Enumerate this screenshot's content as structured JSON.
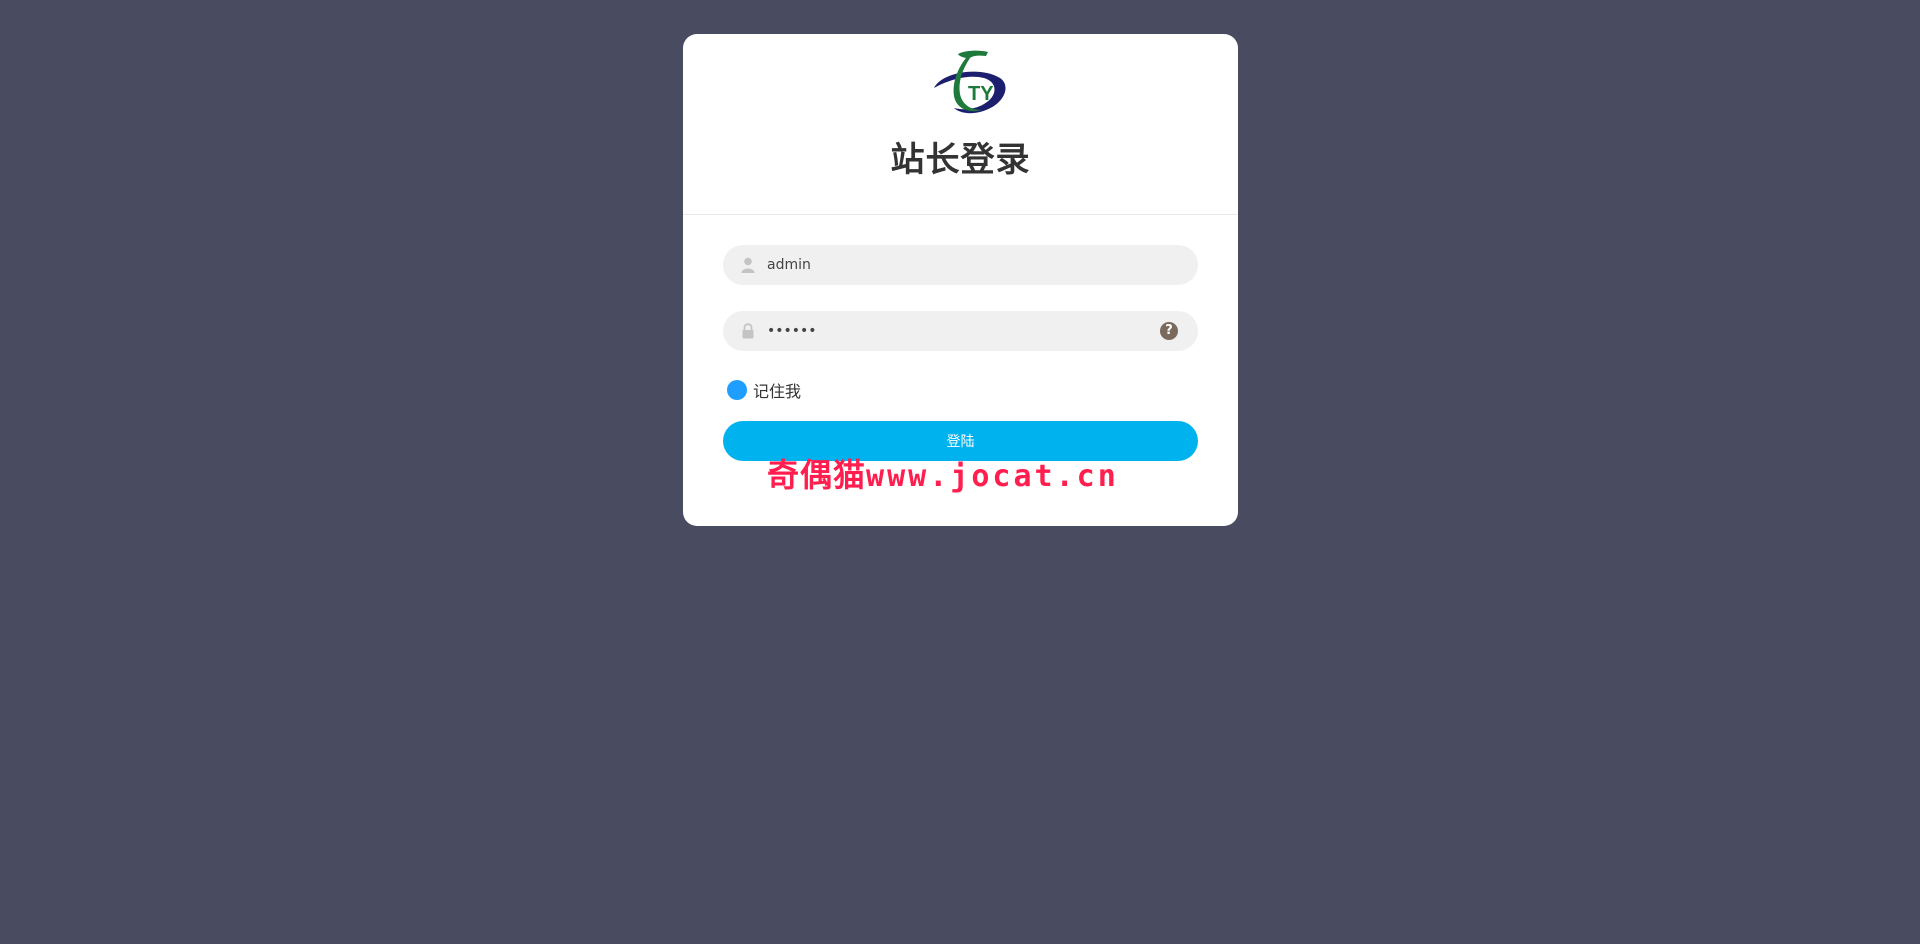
{
  "login": {
    "title": "站长登录",
    "username": {
      "value": "admin",
      "icon": "user-icon"
    },
    "password": {
      "value": "••••••",
      "icon": "lock-icon",
      "help_icon": "question-circle-icon",
      "help_glyph": "?"
    },
    "remember_label": "记住我",
    "submit_label": "登陆"
  },
  "logo": {
    "text": "TY",
    "icon": "ty-logo"
  },
  "watermark": {
    "cn": "奇偶猫",
    "url": "www.jocat.cn"
  },
  "colors": {
    "background": "#494c60",
    "card": "#ffffff",
    "field": "#f0f0f0",
    "button": "#00b2ee",
    "radio": "#1e9fff",
    "watermark": "#ff1e4e",
    "logo_green": "#1d7a3a",
    "logo_navy": "#1c1f6e"
  }
}
